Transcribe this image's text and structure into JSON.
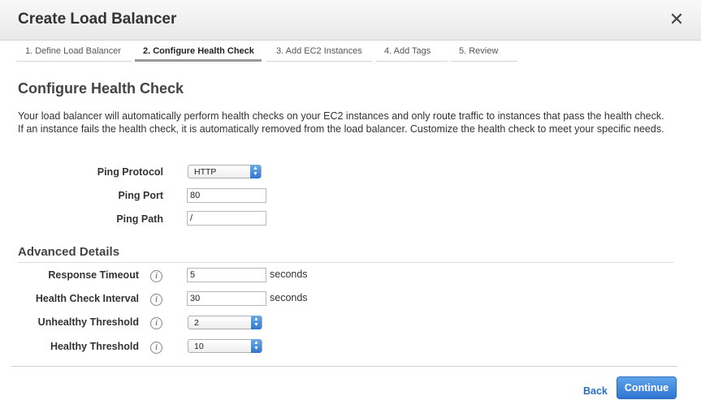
{
  "dialog": {
    "title": "Create Load Balancer",
    "close_glyph": "✕"
  },
  "tabs": [
    {
      "label": "1. Define Load Balancer",
      "active": false
    },
    {
      "label": "2. Configure Health Check",
      "active": true
    },
    {
      "label": "3. Add EC2 Instances",
      "active": false
    },
    {
      "label": "4. Add Tags",
      "active": false
    },
    {
      "label": "5. Review",
      "active": false
    }
  ],
  "section": {
    "title": "Configure Health Check",
    "intro": "Your load balancer will automatically perform health checks on your EC2 instances and only route traffic to instances that pass the health check. If an instance fails the health check, it is automatically removed from the load balancer. Customize the health check to meet your specific needs."
  },
  "ping": {
    "protocol_label": "Ping Protocol",
    "protocol_value": "HTTP",
    "port_label": "Ping Port",
    "port_value": "80",
    "path_label": "Ping Path",
    "path_value": "/"
  },
  "advanced": {
    "title": "Advanced Details",
    "response_timeout_label": "Response Timeout",
    "response_timeout_value": "5",
    "response_timeout_unit": "seconds",
    "interval_label": "Health Check Interval",
    "interval_value": "30",
    "interval_unit": "seconds",
    "unhealthy_label": "Unhealthy Threshold",
    "unhealthy_value": "2",
    "healthy_label": "Healthy Threshold",
    "healthy_value": "10",
    "info_glyph": "i"
  },
  "footer": {
    "back_label": "Back",
    "continue_label": "Continue"
  },
  "icons": {
    "close": "close-icon",
    "info": "info-icon",
    "select_arrow": "select-arrows-icon"
  },
  "colors": {
    "accent_blue": "#2f76d2",
    "link_blue": "#2a6fc5",
    "header_bg": "#eeeeee"
  }
}
